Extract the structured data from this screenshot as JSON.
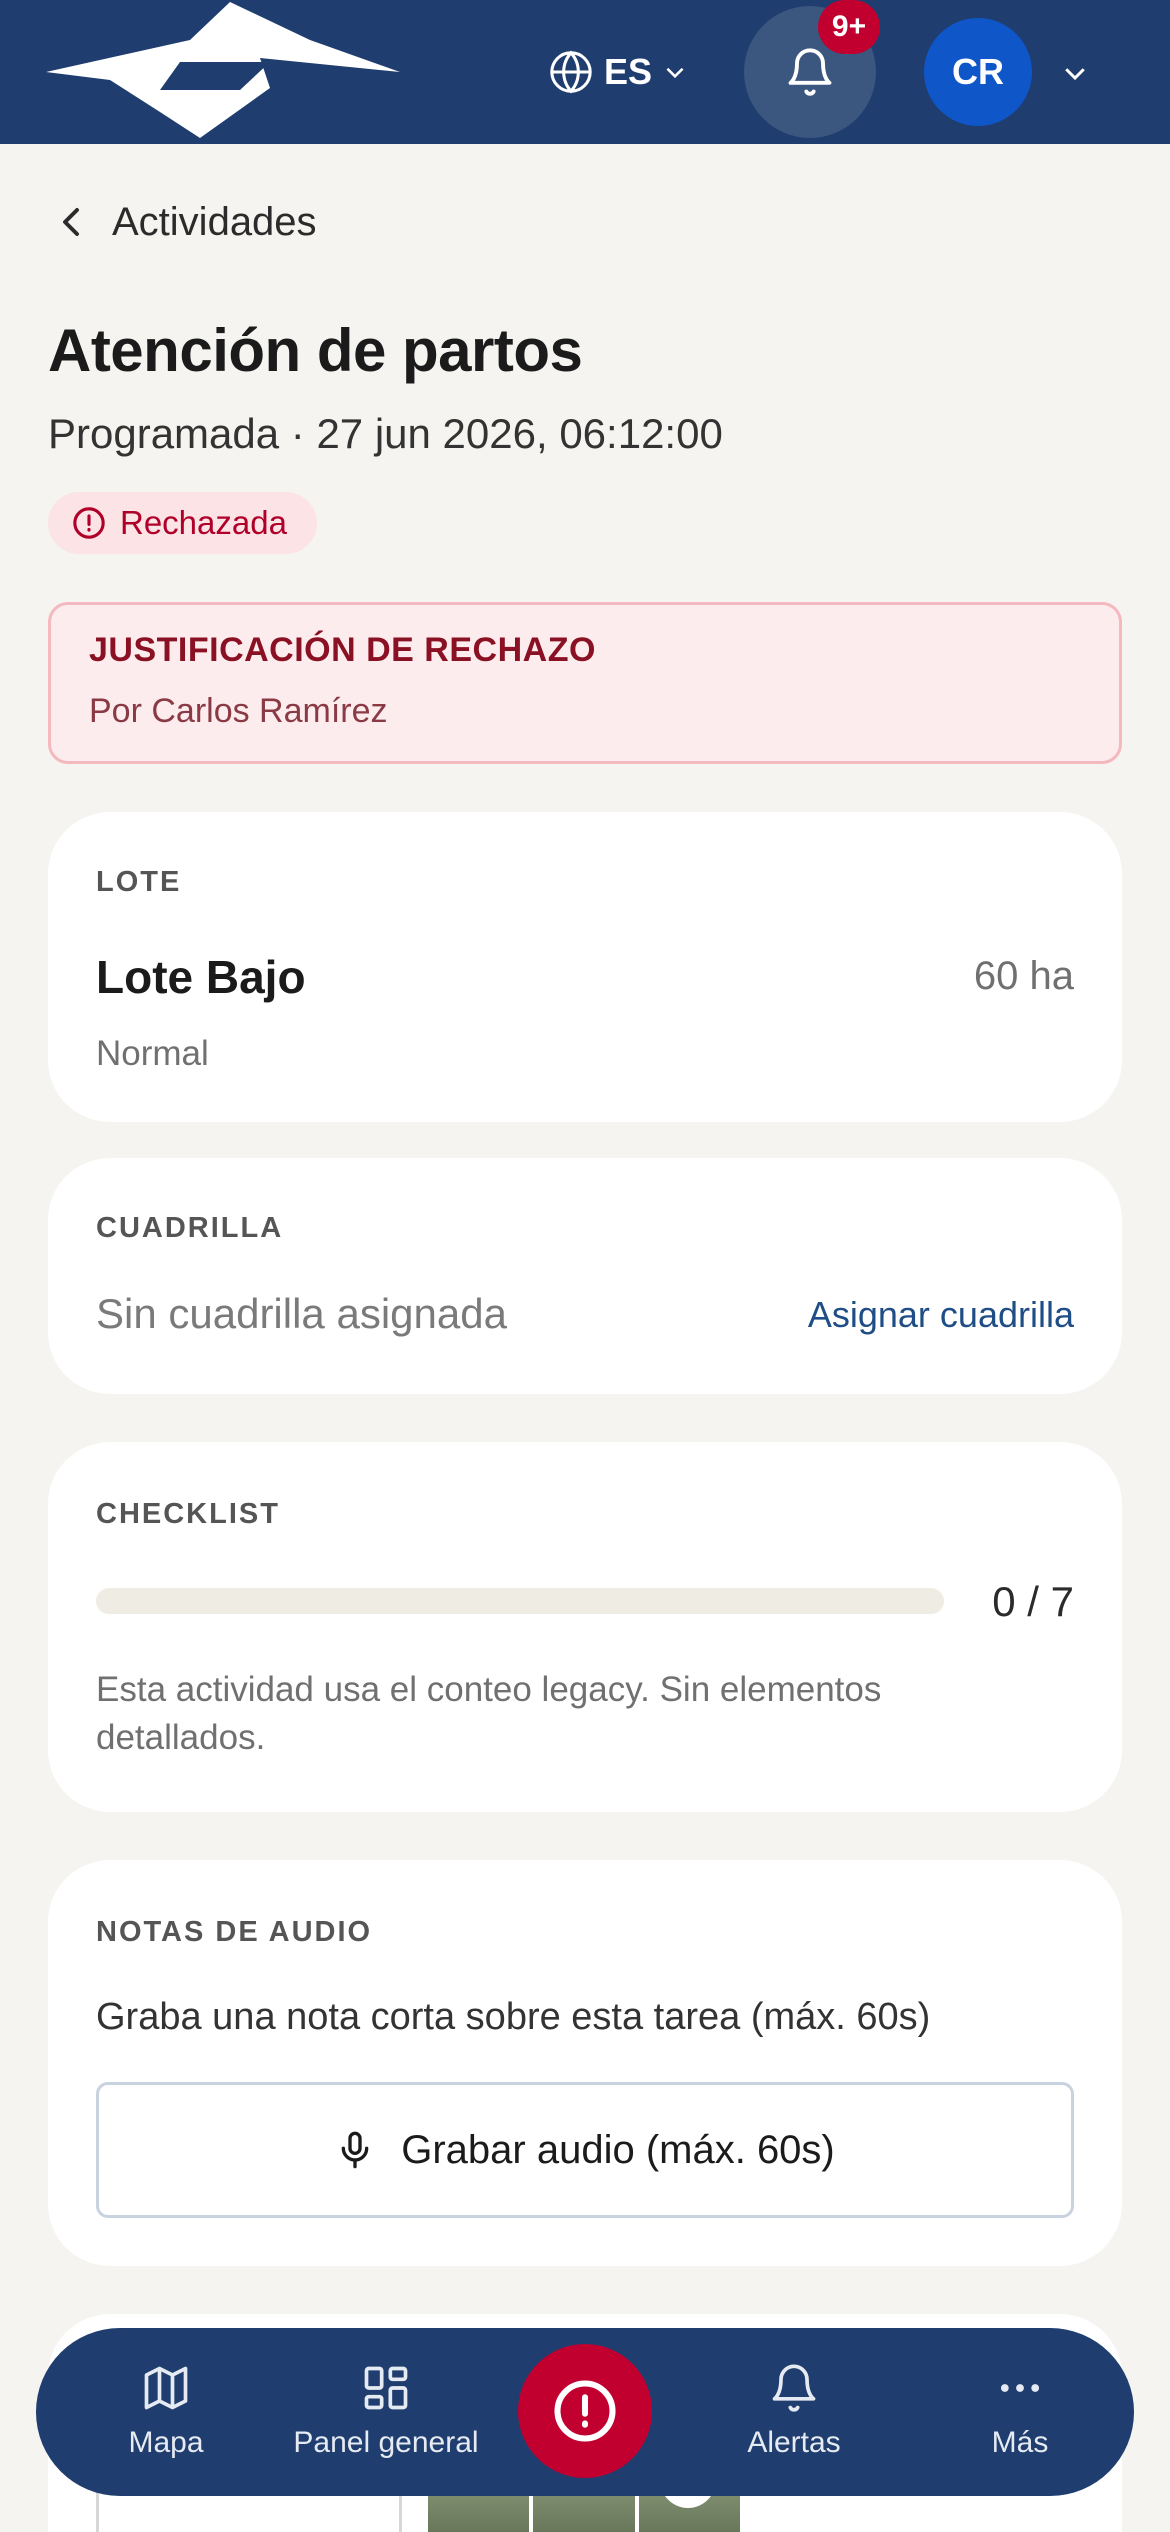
{
  "header": {
    "language": "ES",
    "notifications_badge": "9+",
    "user_initials": "CR"
  },
  "breadcrumb": {
    "back_label": "Actividades"
  },
  "activity": {
    "title": "Atención de partos",
    "subtitle": "Programada · 27 jun 2026, 06:12:00",
    "status": "Rechazada",
    "status_color": "#b0002a"
  },
  "rejection": {
    "title": "JUSTIFICACIÓN DE RECHAZO",
    "by": "Por Carlos Ramírez"
  },
  "lote": {
    "label": "LOTE",
    "name": "Lote Bajo",
    "area": "60 ha",
    "type": "Normal"
  },
  "crew": {
    "label": "CUADRILLA",
    "empty_text": "Sin cuadrilla asignada",
    "assign_label": "Asignar cuadrilla"
  },
  "checklist": {
    "label": "CHECKLIST",
    "count": "0 / 7",
    "completed": 0,
    "total": 7,
    "note": "Esta actividad usa el conteo legacy. Sin elementos detallados."
  },
  "audio": {
    "label": "NOTAS DE AUDIO",
    "description": "Graba una nota corta sobre esta tarea (máx. 60s)",
    "record_label": "Grabar audio (máx. 60s)"
  },
  "bottom_nav": {
    "items": [
      {
        "label": "Mapa",
        "icon": "map-icon"
      },
      {
        "label": "Panel general",
        "icon": "grid-icon"
      },
      {
        "label": "Alertas",
        "icon": "bell-icon"
      },
      {
        "label": "Más",
        "icon": "more-icon"
      }
    ],
    "fab_icon": "alert-circle-icon"
  },
  "colors": {
    "brand": "#1f3d6e",
    "accent_red": "#c1002f",
    "avatar": "#0f57c8",
    "link": "#1f4d85"
  }
}
